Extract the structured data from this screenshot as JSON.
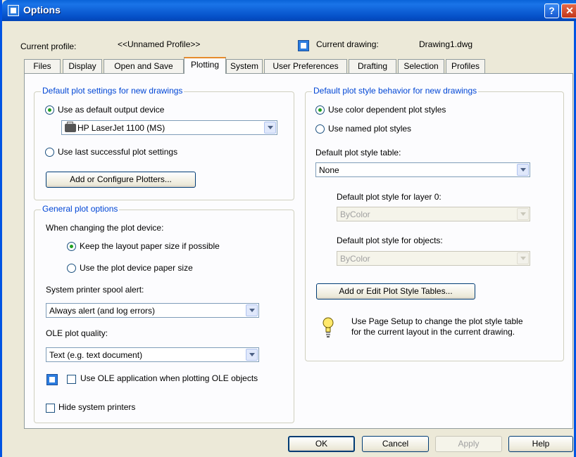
{
  "window": {
    "title": "Options"
  },
  "profile": {
    "current_profile_label": "Current profile:",
    "current_profile_value": "<<Unnamed Profile>>",
    "current_drawing_label": "Current drawing:",
    "current_drawing_value": "Drawing1.dwg"
  },
  "tabs": [
    "Files",
    "Display",
    "Open and Save",
    "Plotting",
    "System",
    "User Preferences",
    "Drafting",
    "Selection",
    "Profiles"
  ],
  "active_tab": "Plotting",
  "default_plot": {
    "title": "Default plot settings for new drawings",
    "use_default_label": "Use as default output device",
    "device_value": "HP LaserJet 1100 (MS)",
    "use_last_label": "Use last successful plot settings",
    "add_plotters_label": "Add or Configure Plotters..."
  },
  "general": {
    "title": "General plot options",
    "changing_label": "When changing the plot device:",
    "keep_layout_label": "Keep the layout paper size if possible",
    "use_device_label": "Use the plot device paper size",
    "spool_label": "System printer spool alert:",
    "spool_value": "Always alert (and log errors)",
    "ole_quality_label": "OLE plot quality:",
    "ole_quality_value": "Text (e.g. text document)",
    "use_ole_label": "Use OLE application when plotting OLE objects",
    "hide_printers_label": "Hide system printers"
  },
  "style": {
    "title": "Default plot style behavior for new drawings",
    "color_dependent_label": "Use color dependent plot styles",
    "named_label": "Use named plot styles",
    "table_label": "Default plot style table:",
    "table_value": "None",
    "layer0_label": "Default plot style for layer 0:",
    "layer0_value": "ByColor",
    "objects_label": "Default plot style for objects:",
    "objects_value": "ByColor",
    "edit_tables_label": "Add or Edit Plot Style Tables...",
    "hint_line1": "Use Page Setup to change the plot style table",
    "hint_line2": "for the current layout in the current drawing."
  },
  "footer": {
    "ok": "OK",
    "cancel": "Cancel",
    "apply": "Apply",
    "help": "Help"
  },
  "colors": {
    "titlebar": "#0a5fd6",
    "group_title": "#0046d5",
    "active_tab_accent": "#e68b2c"
  }
}
